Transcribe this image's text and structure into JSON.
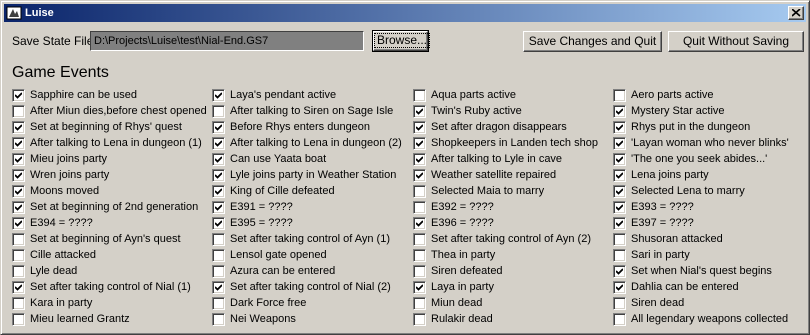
{
  "window": {
    "title": "Luise"
  },
  "toolbar": {
    "save_state_label": "Save State File:",
    "save_state_path": "D:\\Projects\\Luise\\test\\Nial-End.GS7",
    "browse_label": "Browse...",
    "save_quit_label": "Save Changes and Quit",
    "quit_nosave_label": "Quit Without Saving"
  },
  "events_title": "Game Events",
  "columns": [
    [
      {
        "label": "Sapphire can be used",
        "checked": true
      },
      {
        "label": "After Miun dies,before chest opened",
        "checked": false
      },
      {
        "label": "Set at beginning of Rhys' quest",
        "checked": true
      },
      {
        "label": "After talking to Lena in dungeon (1)",
        "checked": true
      },
      {
        "label": "Mieu joins party",
        "checked": true
      },
      {
        "label": "Wren joins party",
        "checked": true
      },
      {
        "label": "Moons moved",
        "checked": true
      },
      {
        "label": "Set at beginning of 2nd generation",
        "checked": true
      },
      {
        "label": "E394 = ????",
        "checked": true
      },
      {
        "label": "Set at beginning of Ayn's quest",
        "checked": false
      },
      {
        "label": "Cille attacked",
        "checked": false
      },
      {
        "label": "Lyle dead",
        "checked": false
      },
      {
        "label": "Set after taking control of Nial (1)",
        "checked": true
      },
      {
        "label": "Kara in party",
        "checked": false
      },
      {
        "label": "Mieu learned Grantz",
        "checked": false
      }
    ],
    [
      {
        "label": "Laya's pendant active",
        "checked": true
      },
      {
        "label": "After talking to Siren on Sage Isle",
        "checked": false
      },
      {
        "label": "Before Rhys enters dungeon",
        "checked": true
      },
      {
        "label": "After talking to Lena in dungeon (2)",
        "checked": true
      },
      {
        "label": "Can use Yaata boat",
        "checked": true
      },
      {
        "label": "Lyle joins party in Weather Station",
        "checked": true
      },
      {
        "label": "King of Cille defeated",
        "checked": true
      },
      {
        "label": "E391 = ????",
        "checked": true
      },
      {
        "label": "E395 = ????",
        "checked": true
      },
      {
        "label": "Set after taking control of Ayn (1)",
        "checked": false
      },
      {
        "label": "Lensol gate opened",
        "checked": false
      },
      {
        "label": "Azura can be entered",
        "checked": false
      },
      {
        "label": "Set after taking control of Nial (2)",
        "checked": true
      },
      {
        "label": "Dark Force free",
        "checked": false
      },
      {
        "label": "Nei Weapons",
        "checked": false
      }
    ],
    [
      {
        "label": "Aqua parts active",
        "checked": false
      },
      {
        "label": "Twin's Ruby active",
        "checked": true
      },
      {
        "label": "Set after dragon disappears",
        "checked": true
      },
      {
        "label": "Shopkeepers in Landen tech shop",
        "checked": true
      },
      {
        "label": "After talking to Lyle in cave",
        "checked": true
      },
      {
        "label": "Weather satellite repaired",
        "checked": true
      },
      {
        "label": "Selected Maia to marry",
        "checked": false
      },
      {
        "label": "E392 = ????",
        "checked": false
      },
      {
        "label": "E396 = ????",
        "checked": true
      },
      {
        "label": "Set after taking control of Ayn (2)",
        "checked": false
      },
      {
        "label": "Thea in party",
        "checked": false
      },
      {
        "label": "Siren defeated",
        "checked": false
      },
      {
        "label": "Laya in party",
        "checked": true
      },
      {
        "label": "Miun dead",
        "checked": false
      },
      {
        "label": "Rulakir dead",
        "checked": false
      }
    ],
    [
      {
        "label": "Aero parts active",
        "checked": false
      },
      {
        "label": "Mystery Star active",
        "checked": true
      },
      {
        "label": "Rhys put in the dungeon",
        "checked": true
      },
      {
        "label": "'Layan woman who never blinks'",
        "checked": true
      },
      {
        "label": "'The one you seek abides...'",
        "checked": true
      },
      {
        "label": "Lena joins party",
        "checked": true
      },
      {
        "label": "Selected Lena to marry",
        "checked": true
      },
      {
        "label": "E393 = ????",
        "checked": true
      },
      {
        "label": "E397 = ????",
        "checked": true
      },
      {
        "label": "Shusoran attacked",
        "checked": false
      },
      {
        "label": "Sari in party",
        "checked": false
      },
      {
        "label": "Set when Nial's quest begins",
        "checked": true
      },
      {
        "label": "Dahlia can be entered",
        "checked": true
      },
      {
        "label": "Siren dead",
        "checked": false
      },
      {
        "label": "All legendary weapons collected",
        "checked": false
      }
    ]
  ]
}
